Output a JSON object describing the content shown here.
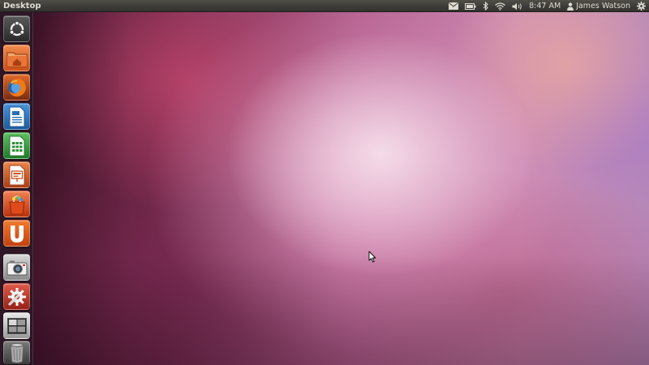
{
  "panel": {
    "title": "Desktop",
    "time": "8:47 AM",
    "user_name": "James Watson"
  },
  "icons": {
    "mail": "envelope-icon",
    "battery": "battery-icon",
    "bluetooth": "bluetooth-icon",
    "network": "wifi-icon",
    "sound": "speaker-icon",
    "user": "user-icon",
    "session": "gear-icon"
  },
  "launcher": {
    "items": [
      {
        "name": "dash-home",
        "icon": "ubuntu-logo-icon",
        "color": "#3a3a3a"
      },
      {
        "name": "home-folder",
        "icon": "home-folder-icon",
        "color": "#e2692b"
      },
      {
        "name": "firefox",
        "icon": "firefox-icon",
        "color": "#b5561c"
      },
      {
        "name": "libreoffice-writer",
        "icon": "writer-document-icon",
        "color": "#2a6fb3"
      },
      {
        "name": "libreoffice-calc",
        "icon": "calc-spreadsheet-icon",
        "color": "#2f8f3a"
      },
      {
        "name": "libreoffice-impress",
        "icon": "impress-presentation-icon",
        "color": "#c6531e"
      },
      {
        "name": "software-center",
        "icon": "shopping-bag-icon",
        "color": "#d9481f"
      },
      {
        "name": "ubuntu-one",
        "icon": "ubuntu-one-icon",
        "color": "#e45a1a"
      },
      {
        "name": "shotwell",
        "icon": "camera-icon",
        "color": "#9e9e9e"
      },
      {
        "name": "system-settings",
        "icon": "settings-wrench-icon",
        "color": "#c23a2e"
      },
      {
        "name": "workspace-switcher",
        "icon": "workspaces-icon",
        "color": "#b8b8b8"
      },
      {
        "name": "trash",
        "icon": "trash-icon",
        "color": "#6a6a6a"
      }
    ]
  },
  "colors": {
    "panel_bg": "#3c3b37",
    "panel_text": "#dfdbd2",
    "accent": "#dd4814"
  }
}
